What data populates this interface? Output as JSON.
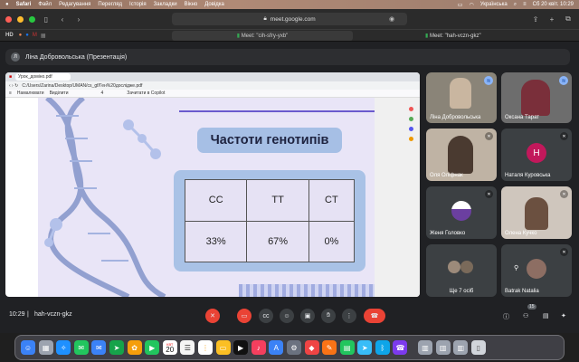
{
  "menubar": {
    "app": "Safari",
    "items": [
      "Файл",
      "Редагування",
      "Перегляд",
      "Історія",
      "Закладки",
      "Вікно",
      "Довідка"
    ],
    "keyboard": "Українська",
    "clock": "Сб 20 квіт.  10:29"
  },
  "safari": {
    "address": "meet.google.com",
    "tabs": [
      "Meet: \"cih-sfry-yxb\"",
      "Meet: \"hah-vczn-gkz\""
    ],
    "favorites": [
      "HD"
    ]
  },
  "meet": {
    "presenter": {
      "initial": "Л",
      "label": "Ліна Добровольська (Презентація)"
    },
    "share": {
      "tab": "Урок_доміно.pdf",
      "path": "C:/Users/Zarina/Desktop/UMAN/cs_gf/Ген%20дослідже.pdf",
      "pdf_tools": [
        "Намалювати",
        "Виділити",
        "Зачитати в Copilot"
      ],
      "page": "4",
      "slide_title": "Частоти генотипів",
      "table": {
        "headers": [
          "CC",
          "TT",
          "CT"
        ],
        "values": [
          "33%",
          "67%",
          "0%"
        ]
      }
    },
    "tiles": [
      {
        "name": "Ліна Добровольська",
        "kind": "video"
      },
      {
        "name": "Оксана Тарат",
        "kind": "video"
      },
      {
        "name": "Оля Оліфнак",
        "kind": "video"
      },
      {
        "name": "Наталя Куровська",
        "kind": "avatar",
        "initial": "Н",
        "color": "#c2185b"
      },
      {
        "name": "Женя Головко",
        "kind": "avatar-photo"
      },
      {
        "name": "Олена Кучко",
        "kind": "video"
      },
      {
        "name": "Ще 7 осіб",
        "kind": "others"
      },
      {
        "name": "Batrak Natalia",
        "kind": "avatar-photo"
      }
    ],
    "meeting_time": "10:29",
    "meeting_code": "hah-vczn-gkz",
    "participants_count": "15"
  },
  "dock": {
    "calendar_day": "20",
    "calendar_month": "КВТ"
  }
}
